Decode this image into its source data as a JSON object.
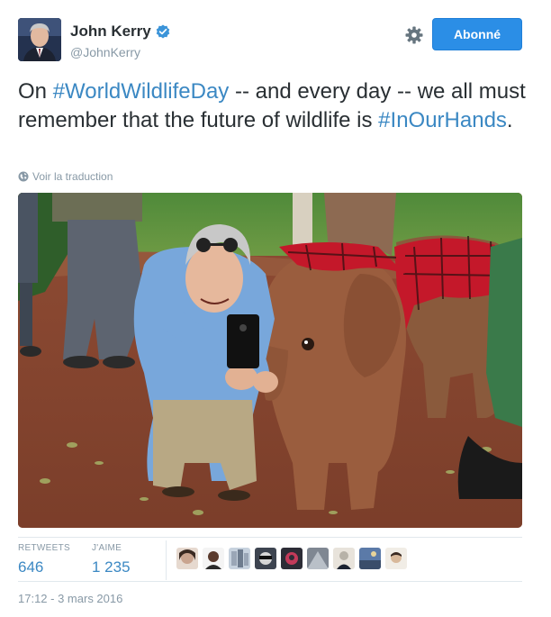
{
  "author": {
    "display_name": "John Kerry",
    "handle": "@JohnKerry",
    "verified": true,
    "avatar_icon": "profile-photo"
  },
  "follow_button": {
    "label": "Abonné"
  },
  "settings_icon": "gear-icon",
  "tweet": {
    "text_parts": [
      {
        "type": "text",
        "value": "On "
      },
      {
        "type": "hashtag",
        "value": "#WorldWildlifeDay"
      },
      {
        "type": "text",
        "value": " -- and every day -- we all must remember that the future of wildlife is "
      },
      {
        "type": "hashtag",
        "value": "#InOurHands"
      },
      {
        "type": "text",
        "value": "."
      }
    ]
  },
  "translate_link": {
    "label": "Voir la traduction",
    "icon": "globe-icon"
  },
  "stats": {
    "retweets_label": "RETWEETS",
    "retweets_value": "646",
    "likes_label": "J'AIME",
    "likes_value": "1 235"
  },
  "likers": [
    {
      "name": "liker-1",
      "color": "#c9a48f"
    },
    {
      "name": "liker-2",
      "color": "#5a3b2e"
    },
    {
      "name": "liker-3",
      "color": "#9aa6b6"
    },
    {
      "name": "liker-4",
      "color": "#3d4450"
    },
    {
      "name": "liker-5",
      "color": "#c33a5a"
    },
    {
      "name": "liker-6",
      "color": "#7f8792"
    },
    {
      "name": "liker-7",
      "color": "#b7b2a8"
    },
    {
      "name": "liker-8",
      "color": "#5b7aa8"
    },
    {
      "name": "liker-9",
      "color": "#d8cfc2"
    }
  ],
  "timestamp": "17:12 - 3 mars 2016",
  "colors": {
    "accent": "#3b88c3",
    "follow_button_bg": "#2b8ee6",
    "muted_text": "#8899a6",
    "verified_badge": "#3b94d9"
  }
}
